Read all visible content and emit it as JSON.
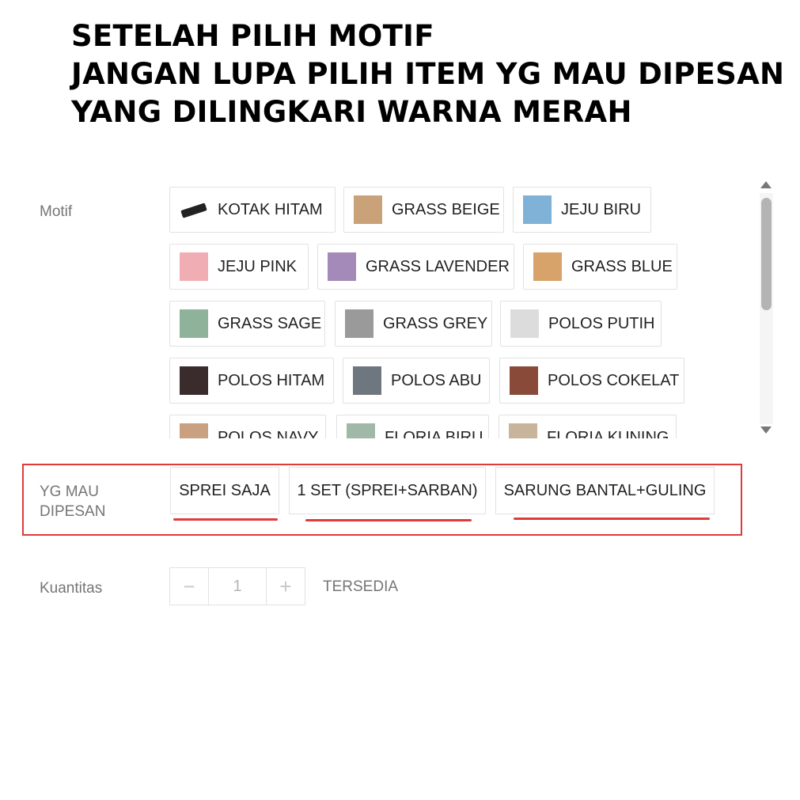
{
  "headline": {
    "line1": "SETELAH PILIH MOTIF",
    "line2": "JANGAN LUPA PILIH ITEM YG MAU DIPESAN",
    "line3": "YANG DILINGKARI WARNA MERAH"
  },
  "motif": {
    "label": "Motif",
    "options": [
      {
        "label": "KOTAK HITAM",
        "thumb": "#2a2a2a"
      },
      {
        "label": "GRASS BEIGE",
        "thumb": "#c9a27a"
      },
      {
        "label": "JEJU BIRU",
        "thumb": "#7fb2d6"
      },
      {
        "label": "JEJU PINK",
        "thumb": "#f0aeb4"
      },
      {
        "label": "GRASS LAVENDER",
        "thumb": "#a48ab8"
      },
      {
        "label": "GRASS BLUE",
        "thumb": "#d7a36a"
      },
      {
        "label": "GRASS SAGE",
        "thumb": "#8fb29a"
      },
      {
        "label": "GRASS GREY",
        "thumb": "#9a9a9a"
      },
      {
        "label": "POLOS PUTIH",
        "thumb": "#dcdcdc"
      },
      {
        "label": "POLOS HITAM",
        "thumb": "#3a2c2c"
      },
      {
        "label": "POLOS ABU",
        "thumb": "#6e7680"
      },
      {
        "label": "POLOS COKELAT",
        "thumb": "#8a4a3a"
      },
      {
        "label": "POLOS NAVY",
        "thumb": "#c9a080"
      },
      {
        "label": "FLORIA BIRU",
        "thumb": "#9fb8a8"
      },
      {
        "label": "FLORIA KUNING",
        "thumb": "#c8b49a"
      }
    ]
  },
  "order": {
    "label_line1": "YG MAU",
    "label_line2": "DIPESAN",
    "options": [
      "SPREI SAJA",
      "1 SET (SPREI+SARBAN)",
      "SARUNG BANTAL+GULING"
    ]
  },
  "quantity": {
    "label": "Kuantitas",
    "minus": "−",
    "value": "1",
    "plus": "+",
    "stock_text": "TERSEDIA"
  },
  "colors": {
    "highlight_red": "#e03a3a",
    "border": "#e2e2e2",
    "label_grey": "#757575"
  }
}
